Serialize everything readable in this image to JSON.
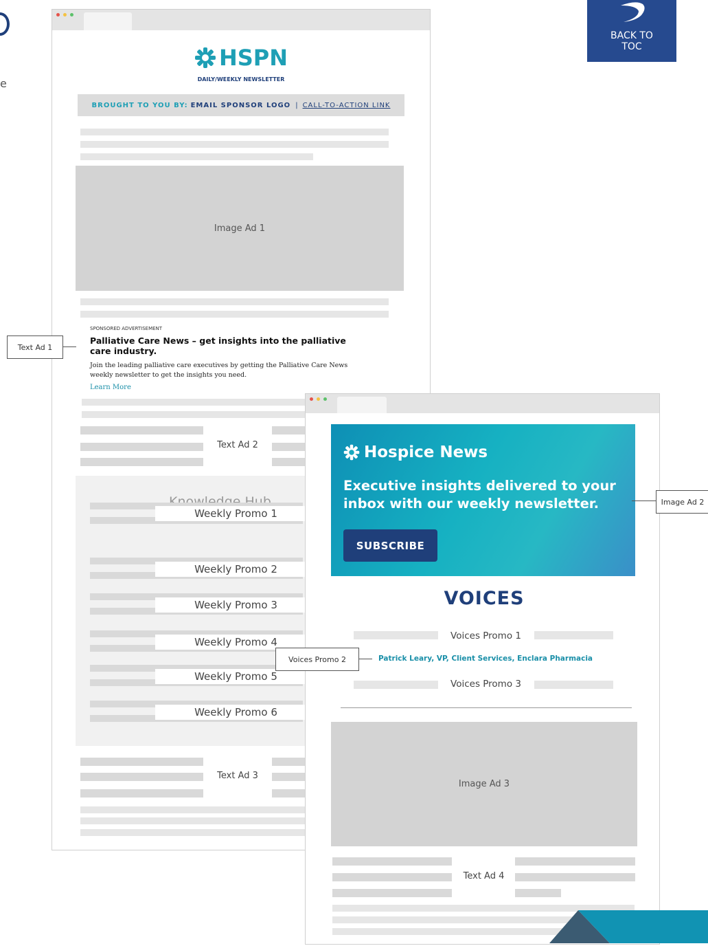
{
  "back_to_toc": {
    "line1": "BACK TO",
    "line2": "TOC"
  },
  "left_edge_text": "e",
  "hspn": {
    "logo": "HSPN",
    "subtitle": "DAILY/WEEKLY NEWSLETTER",
    "sponsor_prefix": "BROUGHT TO YOU BY:",
    "sponsor_logo": "EMAIL SPONSOR LOGO",
    "separator": "|",
    "cta_link": "CALL-TO-ACTION LINK",
    "image_ad_1": "Image Ad 1",
    "sponsored_label": "SPONSORED ADVERTISEMENT",
    "text_ad_headline": "Palliative Care News – get insights into the palliative care industry.",
    "text_ad_body": "Join the leading palliative care executives by getting the Palliative Care News weekly newsletter to get the insights you need.",
    "learn_more": "Learn More",
    "text_ad_2": "Text Ad 2",
    "knowledge_hub": "Knowledge Hub",
    "promos": [
      "Weekly Promo 1",
      "Weekly Promo 2",
      "Weekly Promo 3",
      "Weekly Promo  4",
      "Weekly Promo  5",
      "Weekly Promo  6"
    ],
    "text_ad_3": "Text Ad 3"
  },
  "hospice": {
    "banner_title": "Hospice News",
    "banner_text_line1": "Executive insights delivered to your",
    "banner_text_line2": "inbox with our weekly newsletter.",
    "subscribe": "SUBSCRIBE",
    "voices_logo": "VOICES",
    "voices_promo_1": "Voices Promo 1",
    "voices_promo_2_link": "Patrick Leary, VP, Client Services, Enclara Pharmacia",
    "voices_promo_3": "Voices Promo 3",
    "image_ad_3": "Image Ad 3",
    "text_ad_4": "Text Ad 4"
  },
  "callouts": {
    "text_ad_1": "Text Ad 1",
    "image_ad_2": "Image Ad 2",
    "voices_promo_2": "Voices Promo 2"
  },
  "colors": {
    "hspn_teal": "#1e9fb5",
    "navy": "#1f3f7a",
    "toc_blue": "#264a8f",
    "link_teal": "#1a8fa8"
  }
}
